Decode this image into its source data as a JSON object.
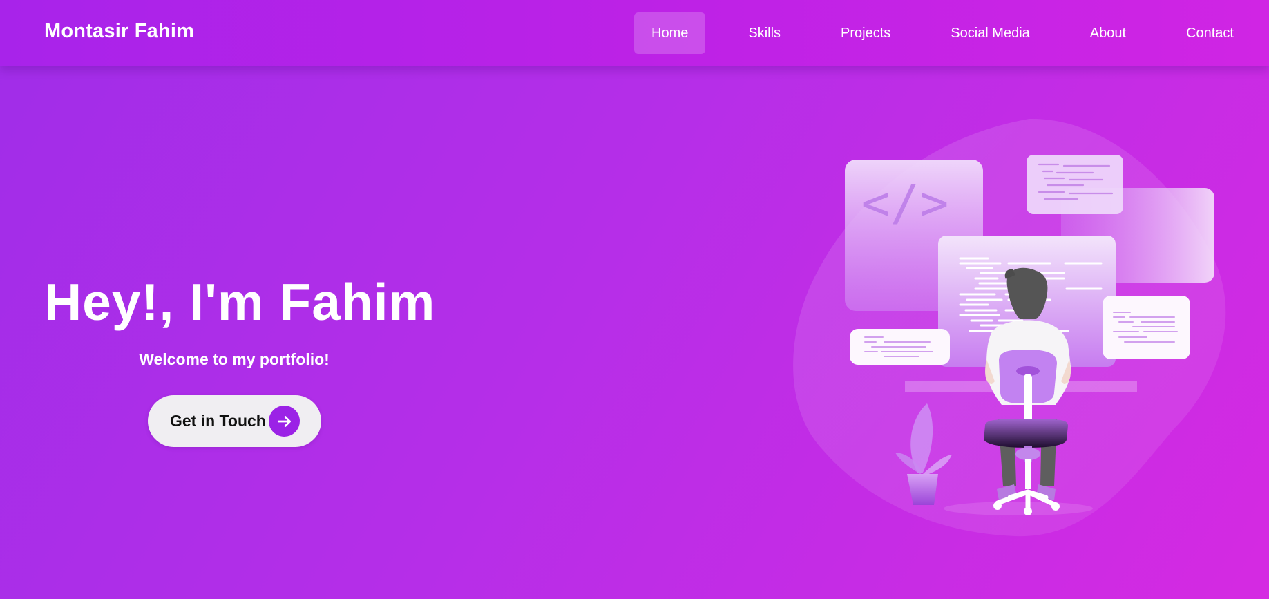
{
  "navbar": {
    "brand": "Montasir Fahim",
    "items": [
      {
        "label": "Home",
        "active": true
      },
      {
        "label": "Skills",
        "active": false
      },
      {
        "label": "Projects",
        "active": false
      },
      {
        "label": "Social Media",
        "active": false
      },
      {
        "label": "About",
        "active": false
      },
      {
        "label": "Contact",
        "active": false
      }
    ]
  },
  "hero": {
    "title": "Hey!, I'm Fahim",
    "subtitle": "Welcome to my portfolio!",
    "cta_label": "Get in Touch",
    "cta_icon": "arrow-right-icon"
  },
  "illustration": {
    "code_icon_text": "</>",
    "icons": [
      "code-icon",
      "developer-figure",
      "office-chair",
      "plant-pot"
    ]
  },
  "colors": {
    "background_start": "#a02de8",
    "background_end": "#d52ae2",
    "accent": "#9b22e6",
    "button_bg": "#f0eef2"
  }
}
